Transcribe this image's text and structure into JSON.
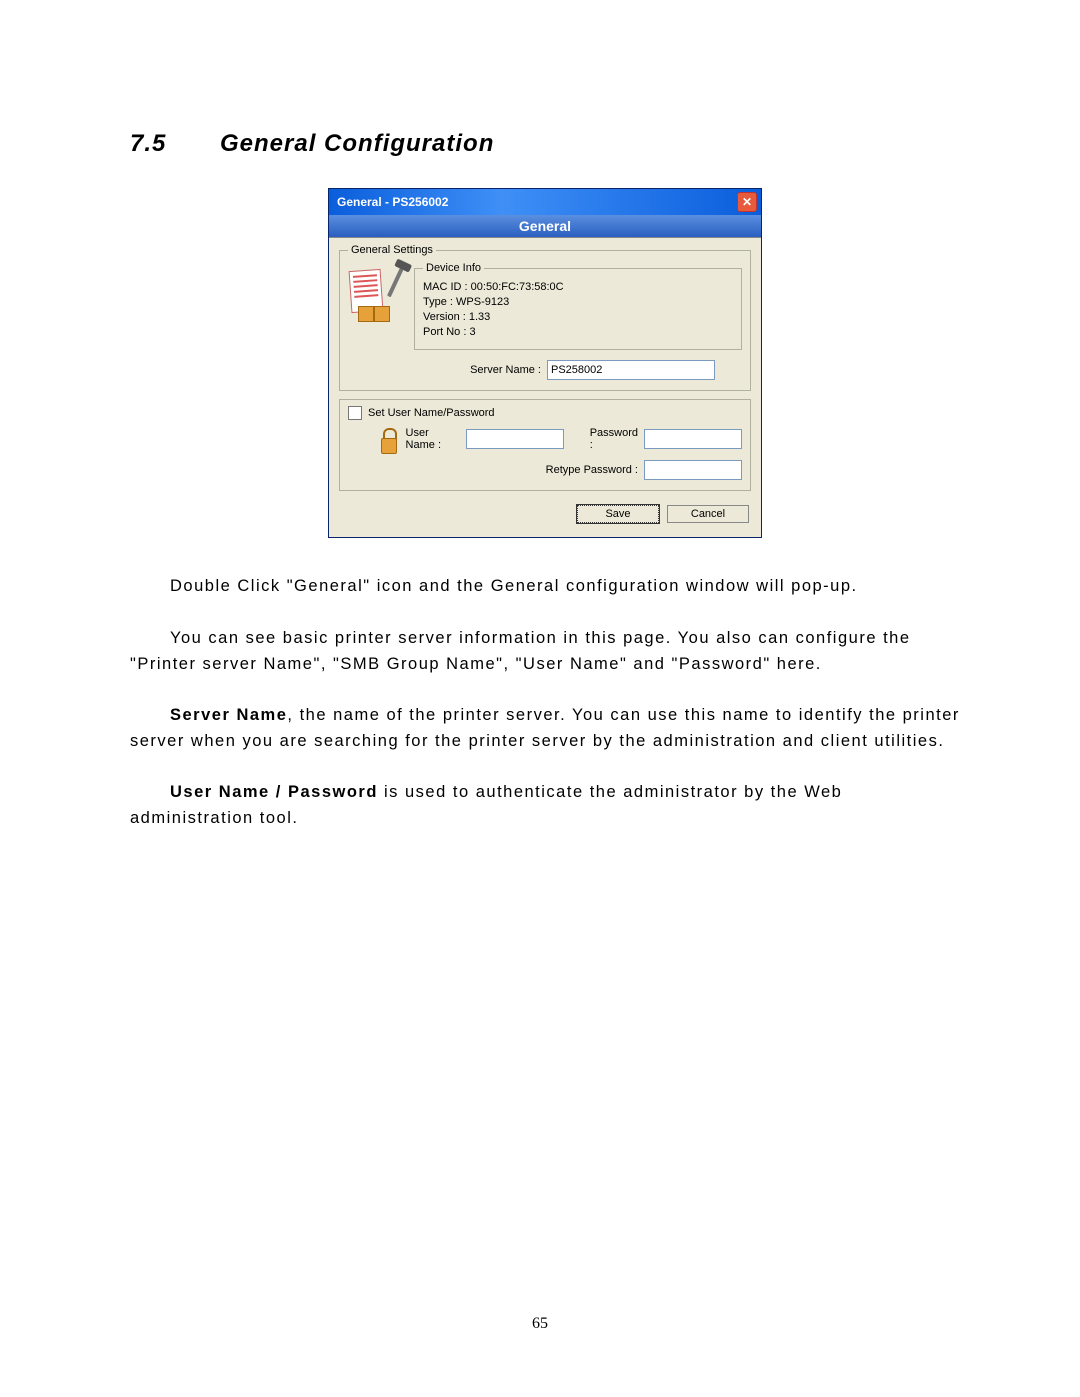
{
  "heading": {
    "number": "7.5",
    "title": "General Configuration"
  },
  "dialog": {
    "title": "General - PS256002",
    "tab": "General",
    "general_settings_legend": "General Settings",
    "device_info_legend": "Device Info",
    "mac_line": "MAC ID : 00:50:FC:73:58:0C",
    "type_line": "Type : WPS-9123",
    "version_line": "Version : 1.33",
    "port_line": "Port No : 3",
    "server_name_label": "Server Name :",
    "server_name_value": "PS258002",
    "set_creds_label": "Set User Name/Password",
    "user_name_label": "User Name :",
    "password_label": "Password :",
    "retype_label": "Retype Password :",
    "save_label": "Save",
    "cancel_label": "Cancel"
  },
  "paragraphs": {
    "p1": "Double Click \"General\" icon and the General configuration window will pop-up.",
    "p2": "You can see basic printer server information in this page. You also can configure the \"Printer server Name\", \"SMB Group Name\", \"User Name\" and \"Password\" here.",
    "p3_bold": "Server Name",
    "p3_rest": ", the name of the printer server. You can use this name to identify the printer server when you are searching for the printer server by the administration and client utilities.",
    "p4_bold": "User Name / Password",
    "p4_rest": " is used to authenticate the administrator by the Web administration tool."
  },
  "page_number": "65"
}
